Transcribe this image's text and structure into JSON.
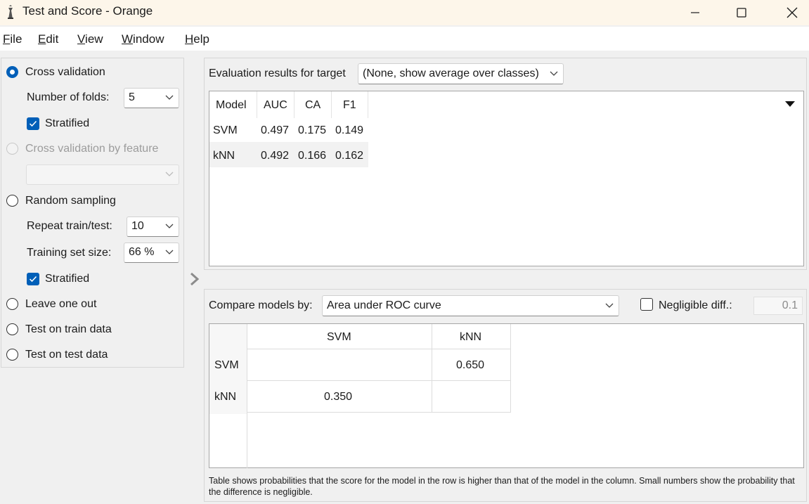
{
  "window": {
    "title": "Test and Score - Orange"
  },
  "menu": [
    {
      "label": "File",
      "ul": "F",
      "rest": "ile"
    },
    {
      "label": "Edit",
      "ul": "E",
      "rest": "dit"
    },
    {
      "label": "View",
      "ul": "V",
      "rest": "iew"
    },
    {
      "label": "Window",
      "ul": "W",
      "rest": "indow"
    },
    {
      "label": "Help",
      "ul": "H",
      "rest": "elp"
    }
  ],
  "sampling": {
    "cross_validation": "Cross validation",
    "folds_label": "Number of folds:",
    "folds_value": "5",
    "stratified_1": "Stratified",
    "cv_by_feature": "Cross validation by feature",
    "feature_value": "",
    "random_sampling": "Random sampling",
    "repeat_label": "Repeat train/test:",
    "repeat_value": "10",
    "train_size_label": "Training set size:",
    "train_size_value": "66 %",
    "stratified_2": "Stratified",
    "leave_one_out": "Leave one out",
    "test_on_train": "Test on train data",
    "test_on_test": "Test on test data",
    "selected": "cross_validation"
  },
  "evaluation": {
    "target_label": "Evaluation results for target",
    "target_value": "(None, show average over classes)",
    "headers": [
      "Model",
      "AUC",
      "CA",
      "F1"
    ],
    "rows": [
      {
        "model": "SVM",
        "auc": "0.497",
        "ca": "0.175",
        "f1": "0.149"
      },
      {
        "model": "kNN",
        "auc": "0.492",
        "ca": "0.166",
        "f1": "0.162"
      }
    ]
  },
  "comparison": {
    "label": "Compare models by:",
    "value": "Area under ROC curve",
    "negligible_label": "Negligible diff.:",
    "negligible_value": "0.1",
    "negligible_checked": false,
    "columns": [
      "SVM",
      "kNN"
    ],
    "rows": [
      {
        "model": "SVM",
        "values": [
          "",
          "0.650"
        ]
      },
      {
        "model": "kNN",
        "values": [
          "0.350",
          ""
        ]
      }
    ],
    "footnote": "Table shows probabilities that the score for the model in the row is higher than that of the model in the column. Small numbers show the probability that the difference is negligible."
  },
  "colors": {
    "accent": "#005fb8",
    "titlebar": "#fdf6ea"
  }
}
